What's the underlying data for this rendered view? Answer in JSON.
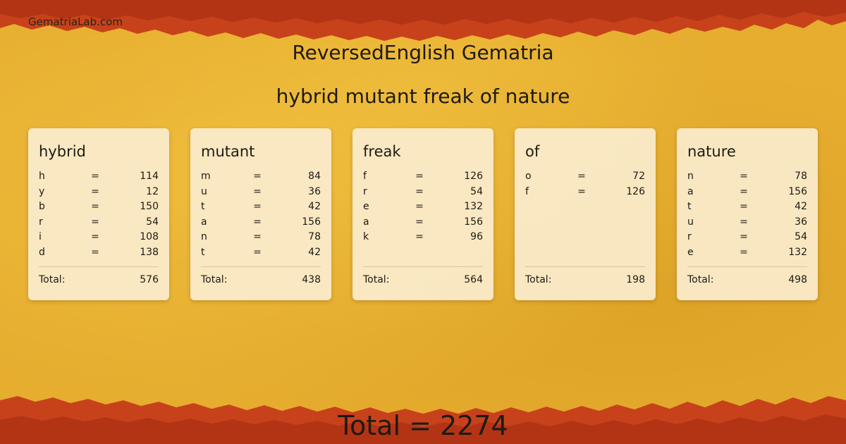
{
  "site": "GematriaLab.com",
  "title": "ReversedEnglish Gematria",
  "phrase": "hybrid mutant freak of nature",
  "eq_symbol": "=",
  "total_label": "Total:",
  "colors": {
    "background": "#e6ad2f",
    "edge": "#c8421a",
    "card": "#faeccc"
  },
  "words": [
    {
      "word": "hybrid",
      "letters": [
        {
          "letter": "h",
          "value": "114"
        },
        {
          "letter": "y",
          "value": "12"
        },
        {
          "letter": "b",
          "value": "150"
        },
        {
          "letter": "r",
          "value": "54"
        },
        {
          "letter": "i",
          "value": "108"
        },
        {
          "letter": "d",
          "value": "138"
        }
      ],
      "total": "576"
    },
    {
      "word": "mutant",
      "letters": [
        {
          "letter": "m",
          "value": "84"
        },
        {
          "letter": "u",
          "value": "36"
        },
        {
          "letter": "t",
          "value": "42"
        },
        {
          "letter": "a",
          "value": "156"
        },
        {
          "letter": "n",
          "value": "78"
        },
        {
          "letter": "t",
          "value": "42"
        }
      ],
      "total": "438"
    },
    {
      "word": "freak",
      "letters": [
        {
          "letter": "f",
          "value": "126"
        },
        {
          "letter": "r",
          "value": "54"
        },
        {
          "letter": "e",
          "value": "132"
        },
        {
          "letter": "a",
          "value": "156"
        },
        {
          "letter": "k",
          "value": "96"
        }
      ],
      "total": "564"
    },
    {
      "word": "of",
      "letters": [
        {
          "letter": "o",
          "value": "72"
        },
        {
          "letter": "f",
          "value": "126"
        }
      ],
      "total": "198"
    },
    {
      "word": "nature",
      "letters": [
        {
          "letter": "n",
          "value": "78"
        },
        {
          "letter": "a",
          "value": "156"
        },
        {
          "letter": "t",
          "value": "42"
        },
        {
          "letter": "u",
          "value": "36"
        },
        {
          "letter": "r",
          "value": "54"
        },
        {
          "letter": "e",
          "value": "132"
        }
      ],
      "total": "498"
    }
  ],
  "grand_total": "Total = 2274"
}
